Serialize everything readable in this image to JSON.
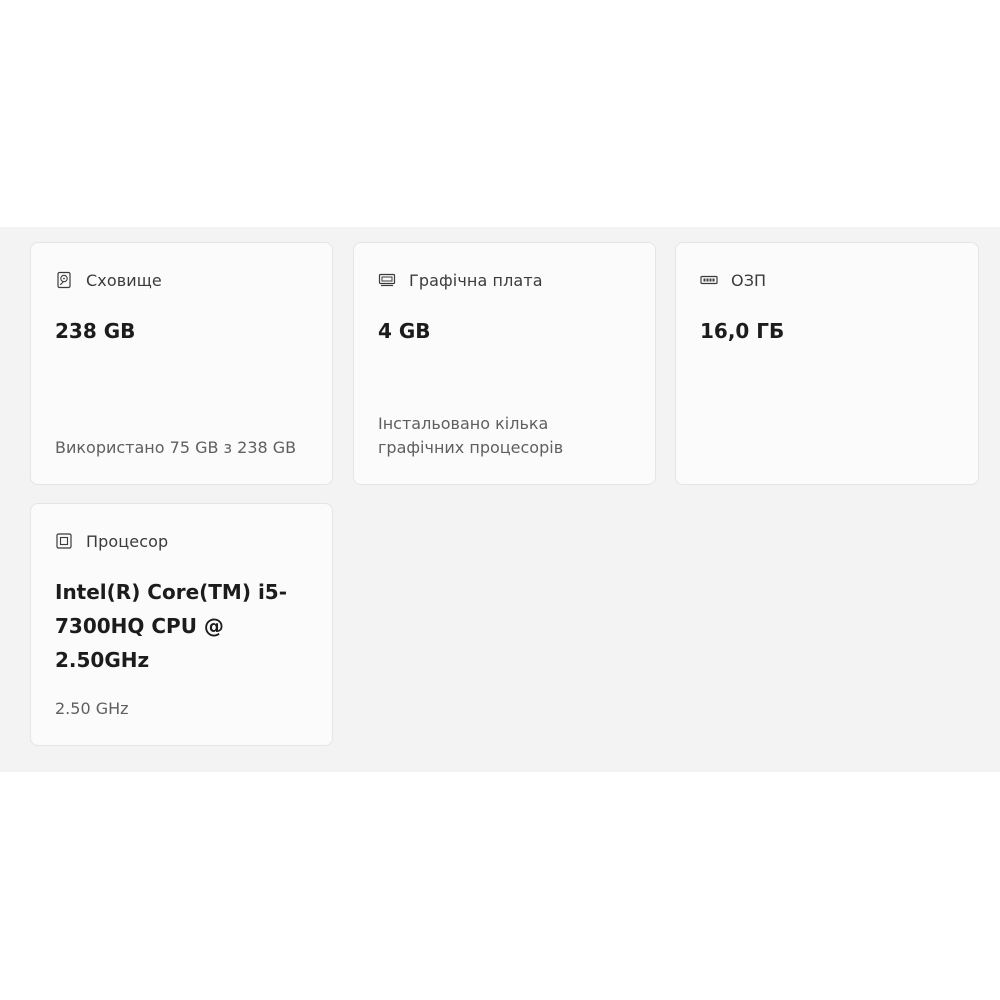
{
  "cards": {
    "storage": {
      "icon": "hard-drive-icon",
      "label": "Сховище",
      "value": "238 GB",
      "sub": "Використано 75 GB з 238 GB"
    },
    "gpu": {
      "icon": "graphics-card-icon",
      "label": "Графічна плата",
      "value": "4 GB",
      "sub": "Інстальовано кілька графічних процесорів"
    },
    "ram": {
      "icon": "memory-icon",
      "label": "ОЗП",
      "value": "16,0 ГБ"
    },
    "cpu": {
      "icon": "processor-icon",
      "label": "Процесор",
      "value": "Intel(R) Core(TM) i5-7300HQ CPU @ 2.50GHz",
      "sub": "2.50 GHz"
    }
  }
}
